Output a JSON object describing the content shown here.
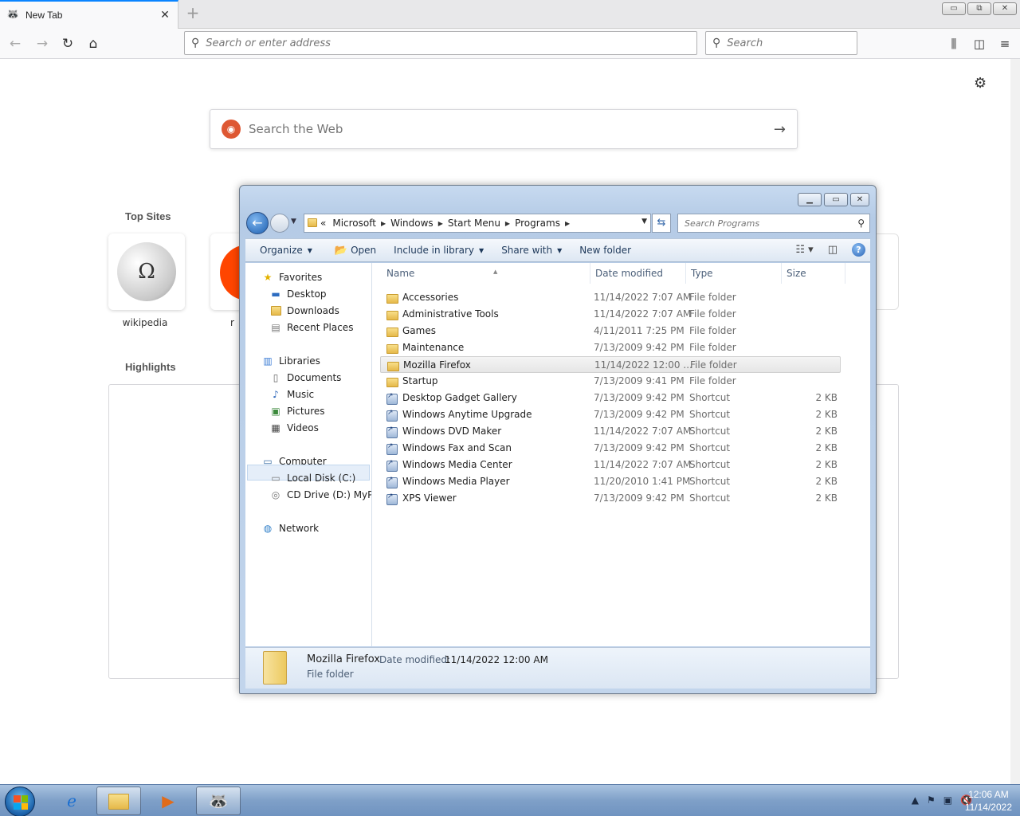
{
  "browser": {
    "tab_title": "New Tab",
    "new_tab_symbol": "+",
    "url_placeholder": "Search or enter address",
    "search_placeholder": "Search",
    "caption_buttons": {
      "minimize": "▭",
      "restore": "⧉",
      "close": "✕"
    }
  },
  "newtab": {
    "websearch_placeholder": "Search the Web",
    "top_sites_title": "Top Sites",
    "highlights_title": "Highlights",
    "top_sites": [
      {
        "label": "wikipedia"
      },
      {
        "label": "r"
      }
    ]
  },
  "explorer": {
    "breadcrumb": {
      "overflow": "«",
      "items": [
        "Microsoft",
        "Windows",
        "Start Menu",
        "Programs"
      ]
    },
    "search_placeholder": "Search Programs",
    "toolbar": {
      "organize": "Organize",
      "open": "Open",
      "include_in_library": "Include in library",
      "share_with": "Share with",
      "new_folder": "New folder"
    },
    "nav": {
      "favorites": "Favorites",
      "desktop": "Desktop",
      "downloads": "Downloads",
      "recent_places": "Recent Places",
      "libraries": "Libraries",
      "documents": "Documents",
      "music": "Music",
      "pictures": "Pictures",
      "videos": "Videos",
      "computer": "Computer",
      "local_disk": "Local Disk (C:)",
      "cd_drive": "CD Drive (D:) MyPal",
      "network": "Network"
    },
    "columns": {
      "name": "Name",
      "date": "Date modified",
      "type": "Type",
      "size": "Size"
    },
    "files": [
      {
        "name": "Accessories",
        "date": "11/14/2022 7:07 AM",
        "type": "File folder",
        "size": "",
        "kind": "folder"
      },
      {
        "name": "Administrative Tools",
        "date": "11/14/2022 7:07 AM",
        "type": "File folder",
        "size": "",
        "kind": "folder"
      },
      {
        "name": "Games",
        "date": "4/11/2011 7:25 PM",
        "type": "File folder",
        "size": "",
        "kind": "folder"
      },
      {
        "name": "Maintenance",
        "date": "7/13/2009 9:42 PM",
        "type": "File folder",
        "size": "",
        "kind": "folder"
      },
      {
        "name": "Mozilla Firefox",
        "date": "11/14/2022 12:00 ...",
        "type": "File folder",
        "size": "",
        "kind": "folder"
      },
      {
        "name": "Startup",
        "date": "7/13/2009 9:41 PM",
        "type": "File folder",
        "size": "",
        "kind": "folder"
      },
      {
        "name": "Desktop Gadget Gallery",
        "date": "7/13/2009 9:42 PM",
        "type": "Shortcut",
        "size": "2 KB",
        "kind": "shortcut"
      },
      {
        "name": "Windows Anytime Upgrade",
        "date": "7/13/2009 9:42 PM",
        "type": "Shortcut",
        "size": "2 KB",
        "kind": "shortcut"
      },
      {
        "name": "Windows DVD Maker",
        "date": "11/14/2022 7:07 AM",
        "type": "Shortcut",
        "size": "2 KB",
        "kind": "shortcut"
      },
      {
        "name": "Windows Fax and Scan",
        "date": "7/13/2009 9:42 PM",
        "type": "Shortcut",
        "size": "2 KB",
        "kind": "shortcut"
      },
      {
        "name": "Windows Media Center",
        "date": "11/14/2022 7:07 AM",
        "type": "Shortcut",
        "size": "2 KB",
        "kind": "shortcut"
      },
      {
        "name": "Windows Media Player",
        "date": "11/20/2010 1:41 PM",
        "type": "Shortcut",
        "size": "2 KB",
        "kind": "shortcut"
      },
      {
        "name": "XPS Viewer",
        "date": "7/13/2009 9:42 PM",
        "type": "Shortcut",
        "size": "2 KB",
        "kind": "shortcut"
      }
    ],
    "selected_row_index": 4,
    "details": {
      "name": "Mozilla Firefox",
      "date_label": "Date modified:",
      "date_value": "11/14/2022 12:00 AM",
      "type": "File folder"
    }
  },
  "taskbar": {
    "clock_time": "12:06 AM",
    "clock_date": "11/14/2022"
  },
  "colors": {
    "firefox_tab_accent": "#0a84ff",
    "explorer_frame": "#b5cbe6",
    "taskbar": "#7fa0c8"
  }
}
